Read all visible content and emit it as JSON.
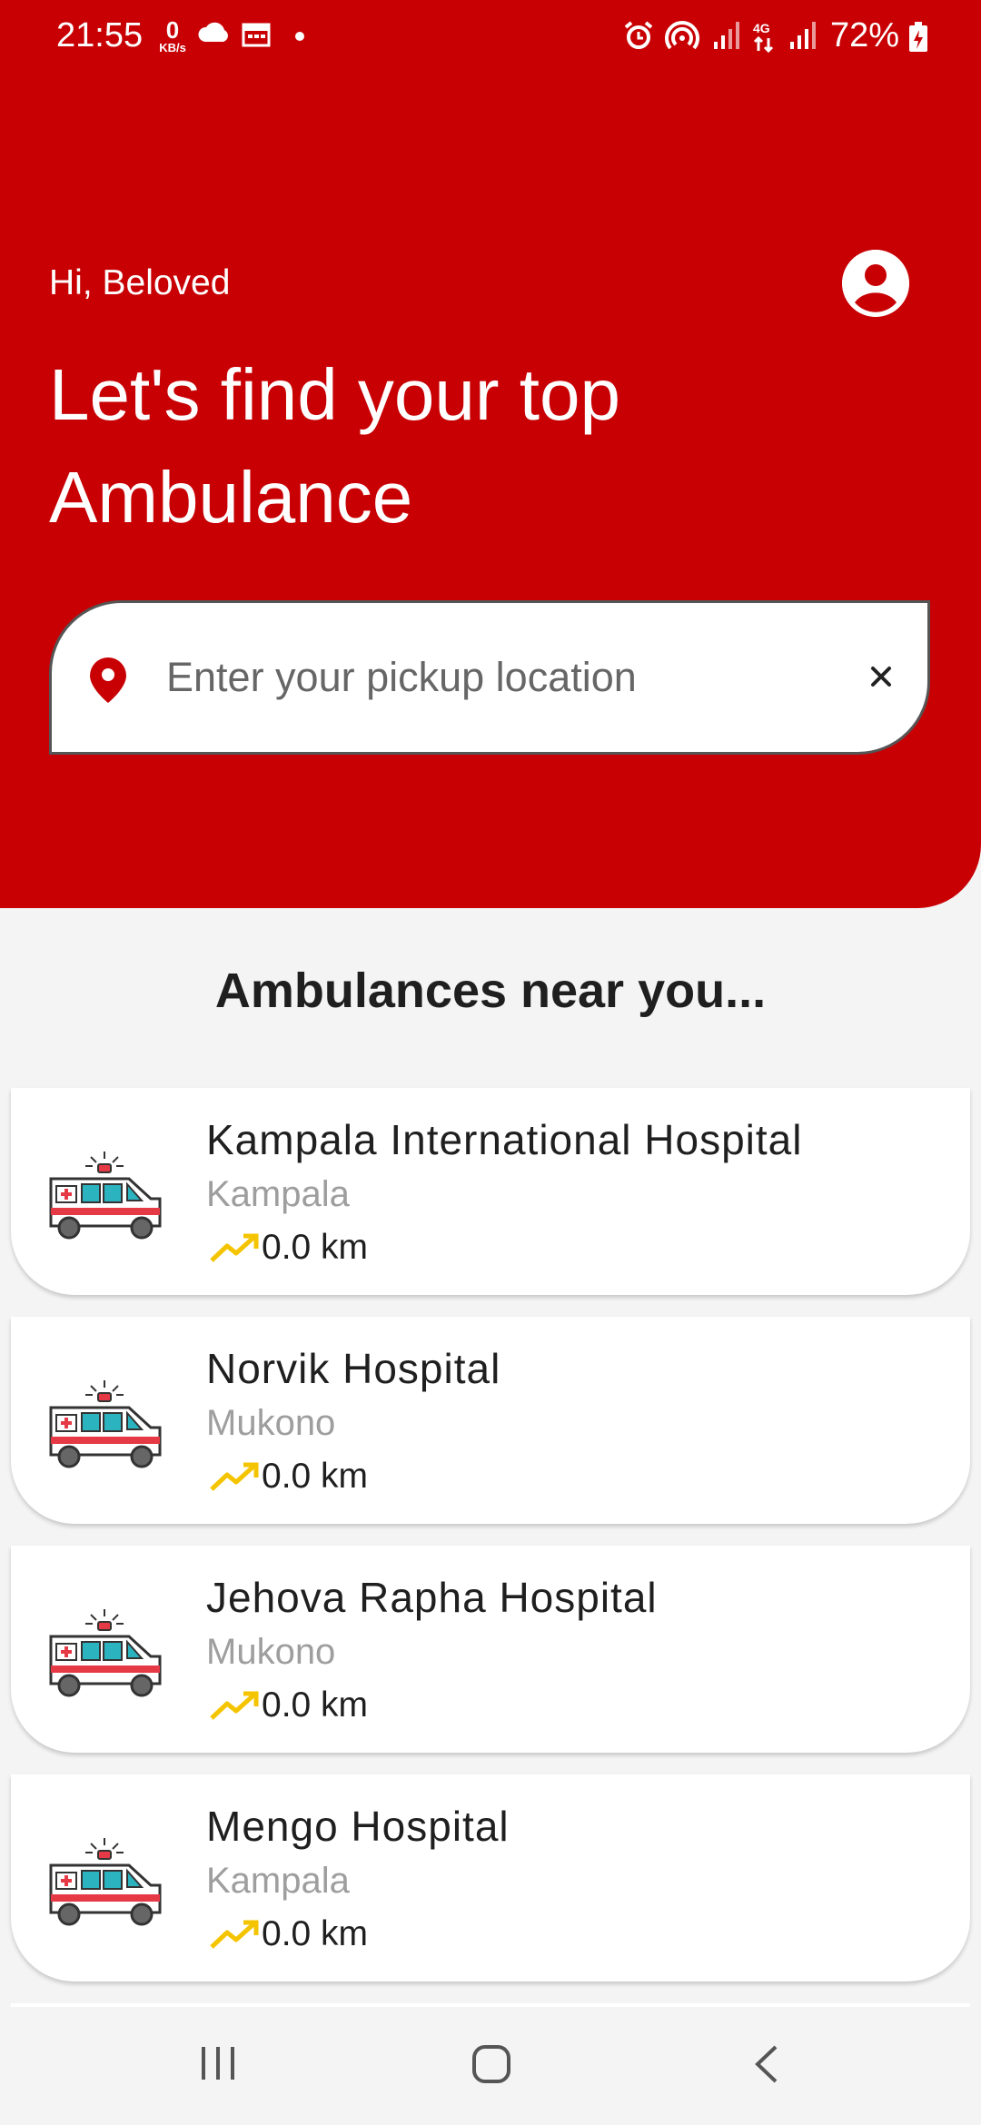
{
  "status_bar": {
    "time": "21:55",
    "net_speed_value": "0",
    "net_speed_unit": "KB/s",
    "battery": "72%"
  },
  "header": {
    "greeting": "Hi, Beloved",
    "headline": "Let's find your top Ambulance",
    "background_color": "#C80003"
  },
  "search": {
    "placeholder": "Enter your pickup location",
    "value": ""
  },
  "list": {
    "title": "Ambulances near you...",
    "items": [
      {
        "name": "Kampala International Hospital",
        "city": "Kampala",
        "distance": "0.0 km"
      },
      {
        "name": "Norvik Hospital",
        "city": "Mukono",
        "distance": "0.0 km"
      },
      {
        "name": "Jehova Rapha Hospital",
        "city": "Mukono",
        "distance": "0.0 km"
      },
      {
        "name": "Mengo Hospital",
        "city": "Kampala",
        "distance": "0.0 km"
      }
    ]
  },
  "icons": {
    "profile": "account-circle-icon",
    "location": "location-pin-icon",
    "clear": "close-icon",
    "ambulance": "ambulance-icon",
    "distance": "trending-up-icon"
  }
}
